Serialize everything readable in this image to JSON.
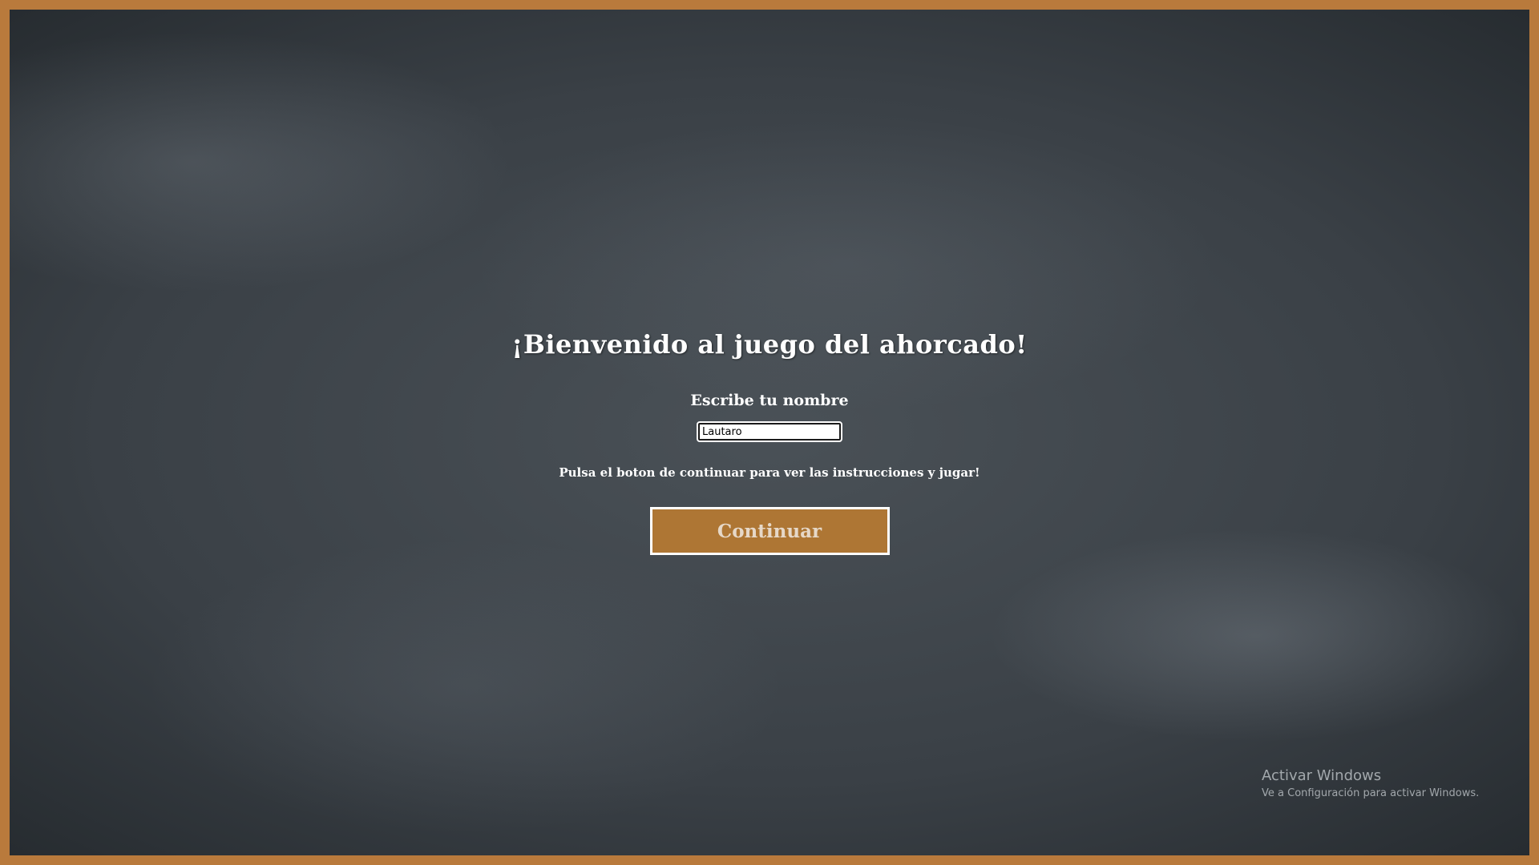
{
  "game": {
    "title": "¡Bienvenido al juego del ahorcado!",
    "name_label": "Escribe tu nombre",
    "name_value": "Lautaro",
    "instructions": "Pulsa el boton de continuar para ver las instrucciones y jugar!",
    "continue_label": "Continuar"
  },
  "watermark": {
    "title": "Activar Windows",
    "subtitle": "Ve a Configuración para activar Windows."
  },
  "colors": {
    "frame": "#b97a3c",
    "button": "#ae7634",
    "chalkboard": "#3a4046"
  }
}
